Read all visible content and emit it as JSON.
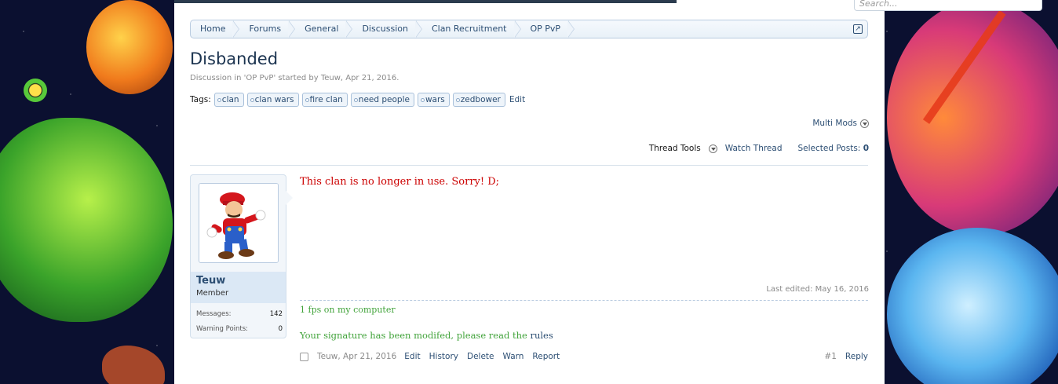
{
  "search": {
    "placeholder": "Search..."
  },
  "breadcrumb": [
    "Home",
    "Forums",
    "General",
    "Discussion",
    "Clan Recruitment",
    "OP PvP"
  ],
  "thread": {
    "title": "Disbanded",
    "meta_prefix": "Discussion in '",
    "meta_forum": "OP PvP",
    "meta_mid": "' started by ",
    "meta_author": "Teuw",
    "meta_suffix": ", Apr 21, 2016."
  },
  "tags": {
    "label": "Tags:",
    "items": [
      "clan",
      "clan wars",
      "fire clan",
      "need people",
      "wars",
      "zedbower"
    ],
    "edit": "Edit"
  },
  "tools": {
    "multi_mods": "Multi Mods",
    "thread_tools": "Thread Tools",
    "watch_thread": "Watch Thread",
    "selected_posts_label": "Selected Posts:",
    "selected_posts_count": "0"
  },
  "post": {
    "user": {
      "name": "Teuw",
      "title": "Member",
      "avatar_icon": "mario-avatar"
    },
    "stats": [
      {
        "label": "Messages:",
        "value": "142"
      },
      {
        "label": "Warning Points:",
        "value": "0"
      }
    ],
    "message": "This clan is no longer in use. Sorry! D;",
    "last_edited": "Last edited: May 16, 2016",
    "signature_line1": "1 fps on my computer",
    "signature_line2_prefix": "Your signature has been modifed, please read the ",
    "signature_line2_link": "rules",
    "footer": {
      "author_date": "Teuw, Apr 21, 2016",
      "actions": [
        "Edit",
        "History",
        "Delete",
        "Warn",
        "Report"
      ],
      "post_number": "#1",
      "reply": "Reply"
    }
  }
}
